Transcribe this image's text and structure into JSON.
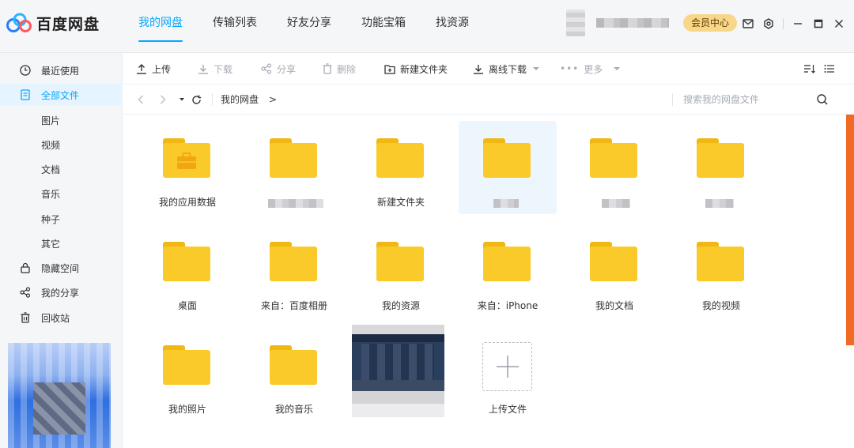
{
  "app": {
    "name": "百度网盘"
  },
  "nav": {
    "tabs": [
      "我的网盘",
      "传输列表",
      "好友分享",
      "功能宝箱",
      "找资源"
    ]
  },
  "user": {
    "vip_label": "会员中心"
  },
  "sidebar": {
    "items": [
      "最近使用",
      "全部文件",
      "图片",
      "视频",
      "文档",
      "音乐",
      "种子",
      "其它",
      "隐藏空间",
      "我的分享",
      "回收站"
    ]
  },
  "toolbar": {
    "upload": "上传",
    "download": "下载",
    "share": "分享",
    "delete": "删除",
    "new_folder": "新建文件夹",
    "offline_download": "离线下载",
    "more": "更多"
  },
  "path": {
    "root": "我的网盘",
    "arrow": ">"
  },
  "search": {
    "placeholder": "搜索我的网盘文件"
  },
  "files": [
    {
      "name": "我的应用数据",
      "type": "folder-app"
    },
    {
      "name": "",
      "type": "folder"
    },
    {
      "name": "新建文件夹",
      "type": "folder"
    },
    {
      "name": "",
      "type": "folder"
    },
    {
      "name": "",
      "type": "folder"
    },
    {
      "name": "",
      "type": "folder"
    },
    {
      "name": "桌面",
      "type": "folder"
    },
    {
      "name": "来自：百度相册",
      "type": "folder"
    },
    {
      "name": "我的资源",
      "type": "folder"
    },
    {
      "name": "来自：iPhone",
      "type": "folder"
    },
    {
      "name": "我的文档",
      "type": "folder"
    },
    {
      "name": "我的视频",
      "type": "folder"
    },
    {
      "name": "我的照片",
      "type": "folder"
    },
    {
      "name": "我的音乐",
      "type": "folder"
    },
    {
      "name": "",
      "type": "image"
    }
  ],
  "upload_tile": {
    "label": "上传文件"
  },
  "colors": {
    "accent": "#06a7ff",
    "folder": "#f9ca2a",
    "folder_tab": "#f1b814",
    "vip": "#f8d789"
  }
}
